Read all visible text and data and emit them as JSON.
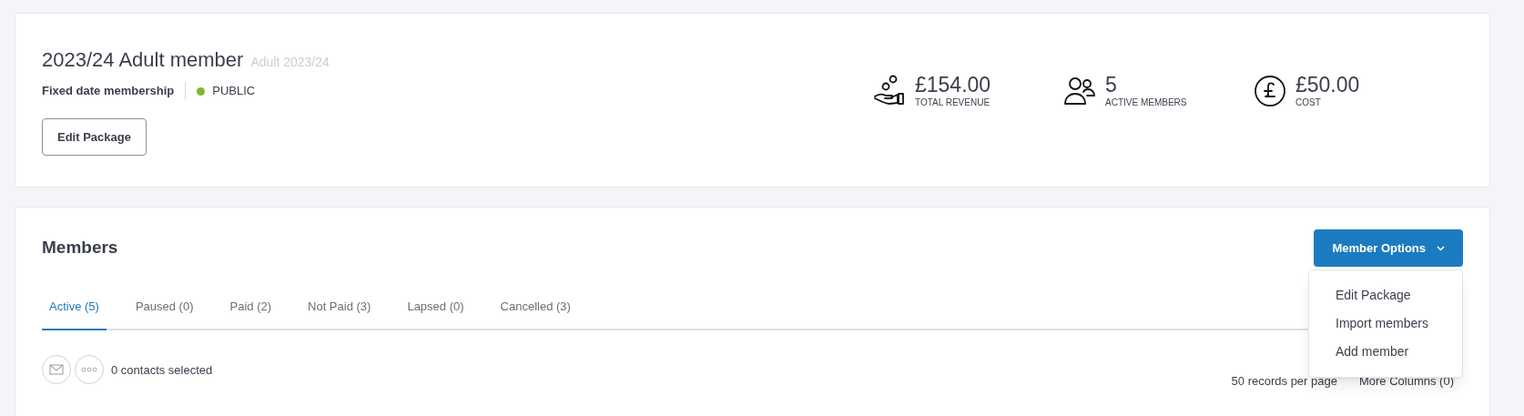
{
  "package": {
    "title": "2023/24 Adult member",
    "subtitle": "Adult 2023/24",
    "type": "Fixed date membership",
    "visibility": {
      "label": "PUBLIC",
      "color": "#7cb82f"
    },
    "edit_button": "Edit Package"
  },
  "stats": [
    {
      "kind": "revenue",
      "value": "£154.00",
      "label": "TOTAL REVENUE"
    },
    {
      "kind": "members",
      "value": "5",
      "label": "ACTIVE MEMBERS"
    },
    {
      "kind": "cost",
      "value": "£50.00",
      "label": "COST"
    }
  ],
  "members": {
    "title": "Members",
    "options_button": "Member Options",
    "menu": [
      "Edit Package",
      "Import members",
      "Add member"
    ],
    "tabs": [
      {
        "label": "Active (5)",
        "selected": true
      },
      {
        "label": "Paused (0)",
        "selected": false
      },
      {
        "label": "Paid (2)",
        "selected": false
      },
      {
        "label": "Not Paid (3)",
        "selected": false
      },
      {
        "label": "Lapsed (0)",
        "selected": false
      },
      {
        "label": "Cancelled (3)",
        "selected": false
      }
    ],
    "selection": "0 contacts selected",
    "per_page": "50 records per page",
    "columns": "More Columns (0)"
  }
}
